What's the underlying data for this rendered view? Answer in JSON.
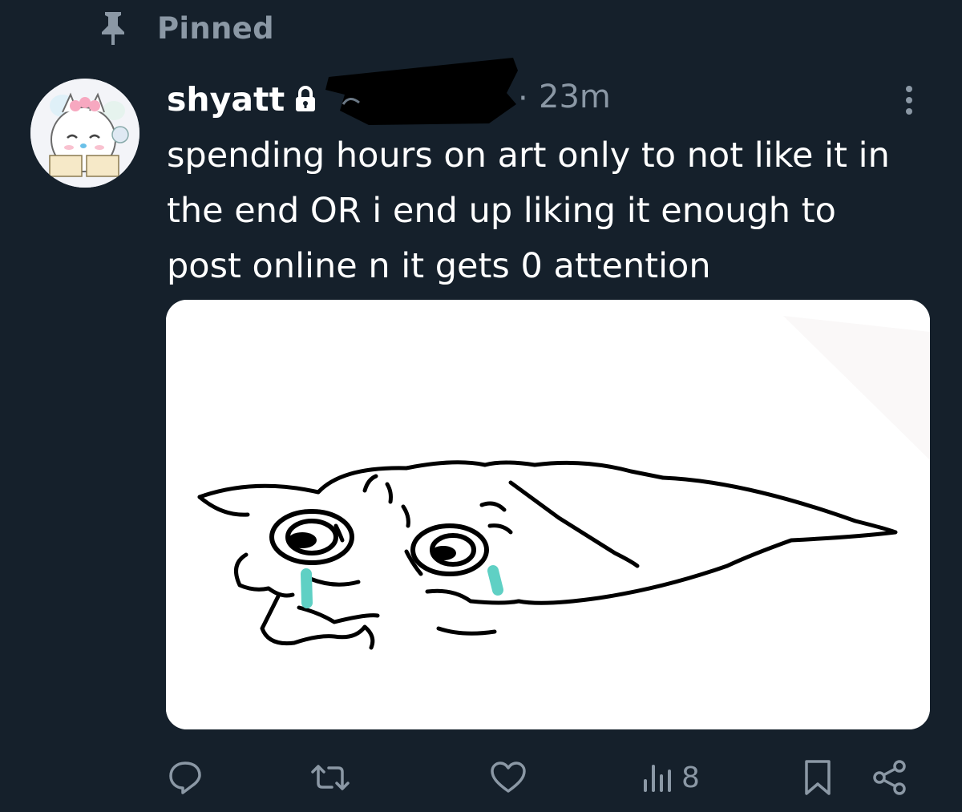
{
  "pinned": {
    "label": "Pinned"
  },
  "post": {
    "display_name": "shyatt",
    "timestamp": "23m",
    "separator": "·",
    "text": "spending hours on art only to not like it in\nthe end OR i end up liking it enough to\npost online n it gets 0 attention",
    "media": {
      "description_icon": "crying-cat-drawing",
      "background": "#ffffff"
    }
  },
  "actions": {
    "views_count": "8"
  },
  "colors": {
    "background": "#15202b",
    "muted": "#8b98a5",
    "text": "#ffffff",
    "tears": "#5fd0c4"
  }
}
